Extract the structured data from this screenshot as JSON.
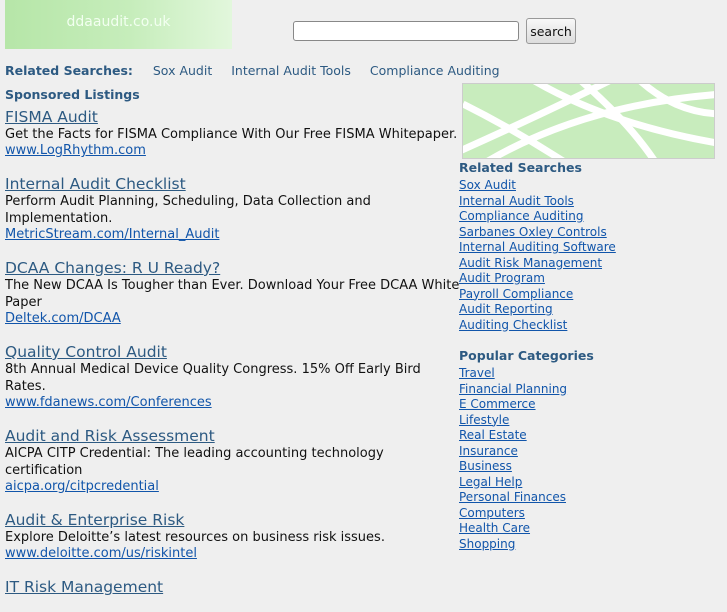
{
  "header": {
    "logo_text": "ddaaudit.co.uk",
    "search_placeholder": "",
    "search_button_label": "search"
  },
  "related_top": {
    "label": "Related Searches:",
    "items": [
      "Sox Audit",
      "Internal Audit Tools",
      "Compliance Auditing"
    ]
  },
  "sponsored_label": "Sponsored Listings",
  "listings": [
    {
      "title": "FISMA Audit",
      "desc": "Get the Facts for FISMA Compliance With Our Free FISMA Whitepaper.",
      "url": "www.LogRhythm.com"
    },
    {
      "title": "Internal Audit Checklist",
      "desc": "Perform Audit Planning, Scheduling, Data Collection and Implementation.",
      "url": "MetricStream.com/Internal_Audit"
    },
    {
      "title": "DCAA Changes: R U Ready?",
      "desc": "The New DCAA Is Tougher than Ever. Download Your Free DCAA White Paper",
      "url": "Deltek.com/DCAA"
    },
    {
      "title": "Quality Control Audit",
      "desc": "8th Annual Medical Device Quality Congress. 15% Off Early Bird Rates.",
      "url": "www.fdanews.com/Conferences"
    },
    {
      "title": "Audit and Risk Assessment",
      "desc": "AICPA CITP Credential: The leading accounting technology certification",
      "url": "aicpa.org/citpcredential"
    },
    {
      "title": "Audit & Enterprise Risk",
      "desc": "Explore Deloitte’s latest resources on business risk issues.",
      "url": "www.deloitte.com/us/riskintel"
    },
    {
      "title": "IT Risk Management",
      "desc": "",
      "url": ""
    }
  ],
  "sidebar": {
    "related_heading": "Related Searches",
    "related_items": [
      "Sox Audit",
      "Internal Audit Tools",
      "Compliance Auditing",
      "Sarbanes Oxley Controls",
      "Internal Auditing Software",
      "Audit Risk Management",
      "Audit Program",
      "Payroll Compliance",
      "Audit Reporting",
      "Auditing Checklist"
    ],
    "popular_heading": "Popular Categories",
    "popular_items": [
      "Travel",
      "Financial Planning",
      "E Commerce",
      "Lifestyle",
      "Real Estate",
      "Insurance",
      "Business",
      "Legal Help",
      "Personal Finances",
      "Computers",
      "Health Care",
      "Shopping"
    ]
  },
  "colors": {
    "accent_link": "#2d5a82",
    "url_link": "#1155aa",
    "logo_green": "#b6e6a8",
    "background": "#efefef"
  }
}
